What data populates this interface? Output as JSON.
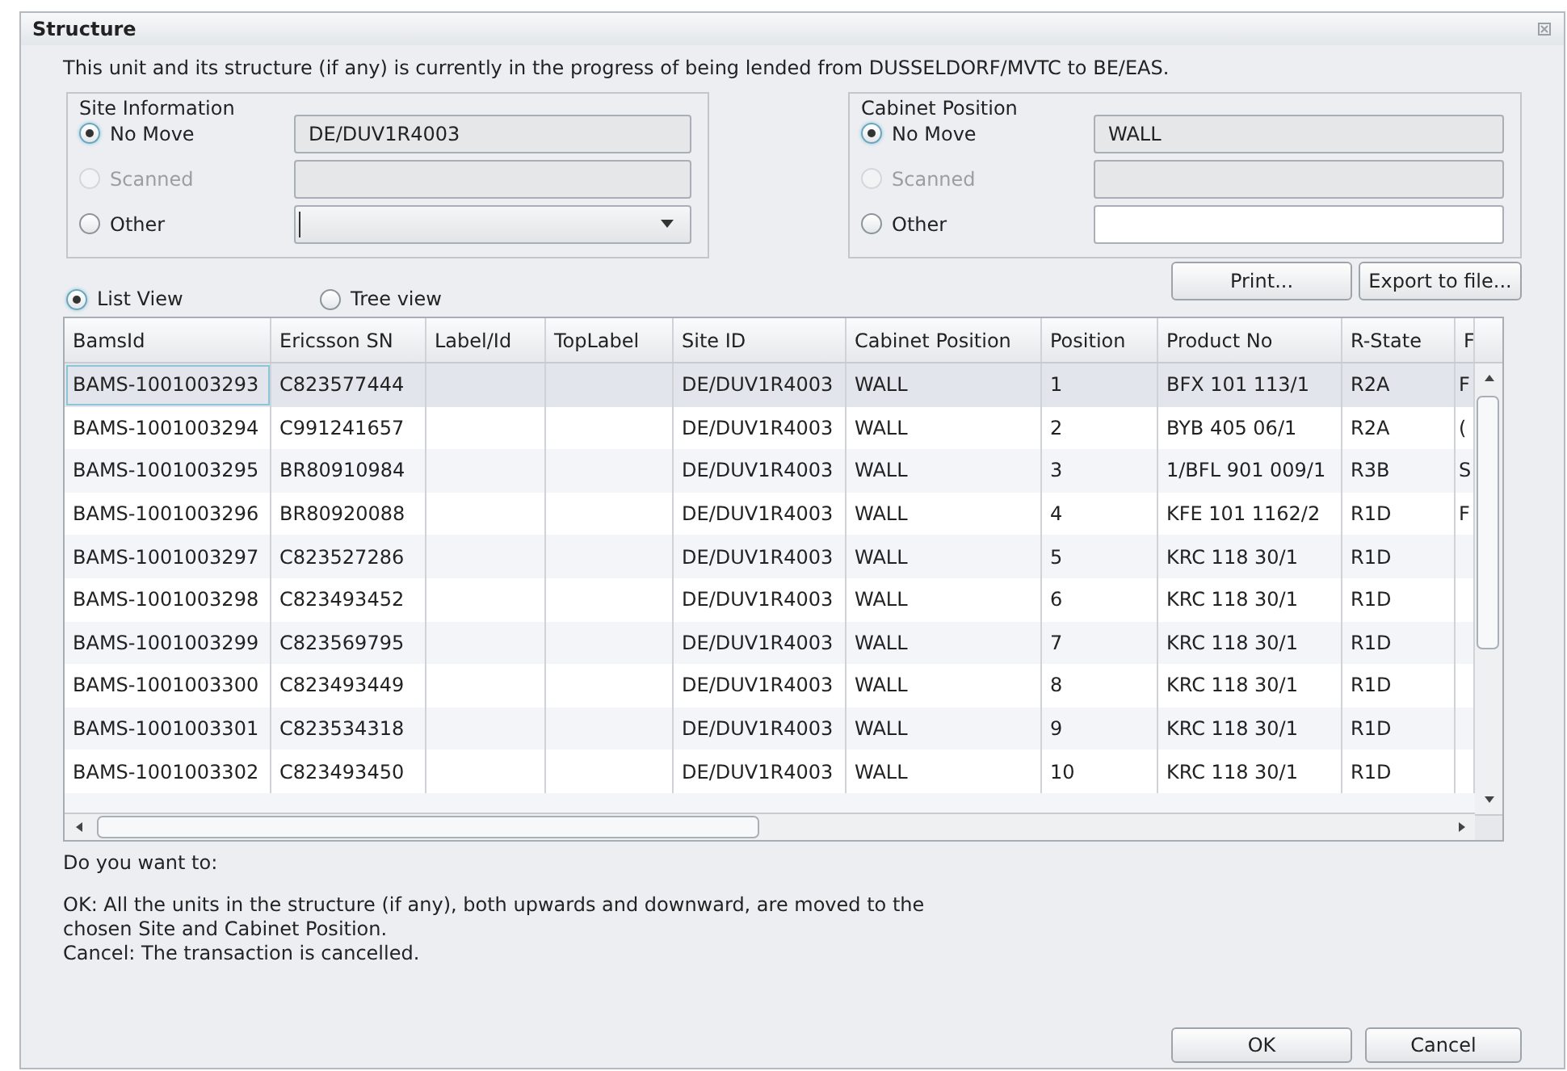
{
  "window": {
    "title": "Structure"
  },
  "message": "This unit and its structure (if any) is currently in the progress of being lended from DUSSELDORF/MVTC to BE/EAS.",
  "site_information": {
    "title": "Site Information",
    "options": [
      {
        "label": "No Move",
        "selected": true,
        "disabled": false,
        "field": {
          "kind": "text",
          "readonly": true,
          "value": "DE/DUV1R4003"
        }
      },
      {
        "label": "Scanned",
        "selected": false,
        "disabled": true,
        "field": {
          "kind": "text",
          "readonly": true
        }
      },
      {
        "label": "Other",
        "selected": false,
        "disabled": false,
        "field": {
          "kind": "combo",
          "readonly": true
        }
      }
    ]
  },
  "cabinet_position": {
    "title": "Cabinet Position",
    "options": [
      {
        "label": "No Move",
        "selected": true,
        "disabled": false,
        "field": {
          "kind": "text",
          "readonly": true,
          "value": "WALL"
        }
      },
      {
        "label": "Scanned",
        "selected": false,
        "disabled": true,
        "field": {
          "kind": "text",
          "readonly": true
        }
      },
      {
        "label": "Other",
        "selected": false,
        "disabled": false,
        "field": {
          "kind": "text",
          "readonly": false
        }
      }
    ]
  },
  "view_options": [
    {
      "label": "List View",
      "selected": true
    },
    {
      "label": "Tree view",
      "selected": false
    }
  ],
  "toolbar_buttons": [
    "Print...",
    "Export to file..."
  ],
  "table": {
    "columns": [
      "BamsId",
      "Ericsson SN",
      "Label/Id",
      "TopLabel",
      "Site ID",
      "Cabinet Position",
      "Position",
      "Product No",
      "R-State",
      "F"
    ],
    "rows": [
      {
        "selected": true,
        "cells": [
          "BAMS-1001003293",
          "C823577444",
          null,
          null,
          "DE/DUV1R4003",
          "WALL",
          "1",
          "BFX 101 113/1",
          "R2A",
          "F"
        ]
      },
      {
        "selected": false,
        "cells": [
          "BAMS-1001003294",
          "C991241657",
          null,
          null,
          "DE/DUV1R4003",
          "WALL",
          "2",
          "BYB 405 06/1",
          "R2A",
          "("
        ]
      },
      {
        "selected": false,
        "cells": [
          "BAMS-1001003295",
          "BR80910984",
          null,
          null,
          "DE/DUV1R4003",
          "WALL",
          "3",
          "1/BFL 901 009/1",
          "R3B",
          "S"
        ]
      },
      {
        "selected": false,
        "cells": [
          "BAMS-1001003296",
          "BR80920088",
          null,
          null,
          "DE/DUV1R4003",
          "WALL",
          "4",
          "KFE 101 1162/2",
          "R1D",
          "F"
        ]
      },
      {
        "selected": false,
        "cells": [
          "BAMS-1001003297",
          "C823527286",
          null,
          null,
          "DE/DUV1R4003",
          "WALL",
          "5",
          "KRC 118 30/1",
          "R1D",
          null
        ]
      },
      {
        "selected": false,
        "cells": [
          "BAMS-1001003298",
          "C823493452",
          null,
          null,
          "DE/DUV1R4003",
          "WALL",
          "6",
          "KRC 118 30/1",
          "R1D",
          null
        ]
      },
      {
        "selected": false,
        "cells": [
          "BAMS-1001003299",
          "C823569795",
          null,
          null,
          "DE/DUV1R4003",
          "WALL",
          "7",
          "KRC 118 30/1",
          "R1D",
          null
        ]
      },
      {
        "selected": false,
        "cells": [
          "BAMS-1001003300",
          "C823493449",
          null,
          null,
          "DE/DUV1R4003",
          "WALL",
          "8",
          "KRC 118 30/1",
          "R1D",
          null
        ]
      },
      {
        "selected": false,
        "cells": [
          "BAMS-1001003301",
          "C823534318",
          null,
          null,
          "DE/DUV1R4003",
          "WALL",
          "9",
          "KRC 118 30/1",
          "R1D",
          null
        ]
      },
      {
        "selected": false,
        "cells": [
          "BAMS-1001003302",
          "C823493450",
          null,
          null,
          "DE/DUV1R4003",
          "WALL",
          "10",
          "KRC 118 30/1",
          "R1D",
          null
        ]
      }
    ]
  },
  "prompt": "Do you want to:",
  "explanations": [
    "OK: All the units in the structure (if any), both upwards and downward, are moved to the chosen Site and Cabinet Position.",
    "Cancel: The transaction is cancelled."
  ],
  "buttons": [
    "OK",
    "Cancel"
  ]
}
